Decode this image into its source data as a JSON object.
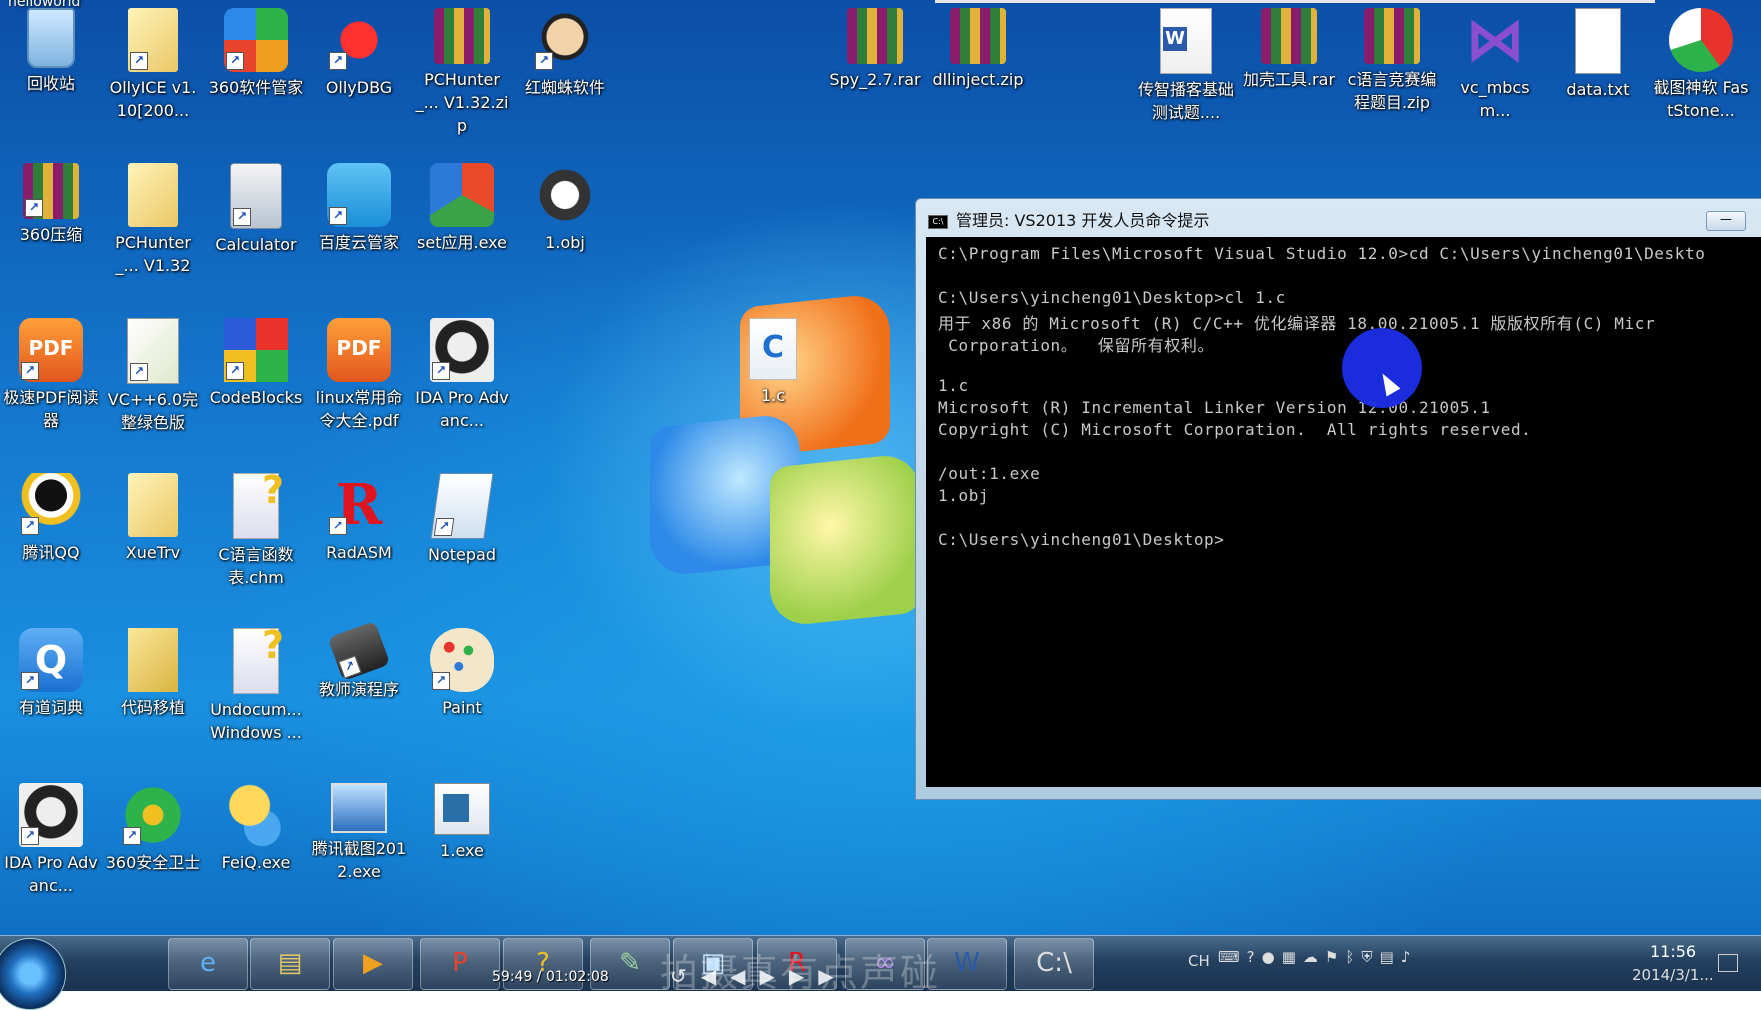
{
  "top_caption": "helloworld",
  "desktop_icons": [
    {
      "label": "回收站",
      "icon": "recycle-bin-icon"
    },
    {
      "label": "OllyICE v1.10[200...",
      "icon": "folder-icon"
    },
    {
      "label": "360软件管家",
      "icon": "360-software-manager-icon"
    },
    {
      "label": "OllyDBG",
      "icon": "ollydbg-icon"
    },
    {
      "label": "PCHunter_... V1.32.zip",
      "icon": "winrar-archive-icon"
    },
    {
      "label": "红蜘蛛软件",
      "icon": "red-spider-icon"
    },
    {
      "label": "Spy_2.7.rar",
      "icon": "winrar-archive-icon"
    },
    {
      "label": "dllinject.zip",
      "icon": "winrar-archive-icon"
    },
    {
      "label": "传智播客基础测试题....",
      "icon": "word-document-icon"
    },
    {
      "label": "加壳工具.rar",
      "icon": "winrar-archive-icon"
    },
    {
      "label": "c语言竞赛编程题目.zip",
      "icon": "winrar-archive-icon"
    },
    {
      "label": "vc_mbcsm...",
      "icon": "visual-studio-icon"
    },
    {
      "label": "data.txt",
      "icon": "text-file-icon"
    },
    {
      "label": "截图神软 FastStone...",
      "icon": "faststone-icon"
    },
    {
      "label": "360压缩",
      "icon": "winrar-archive-icon"
    },
    {
      "label": "PCHunter_... V1.32",
      "icon": "folder-icon"
    },
    {
      "label": "Calculator",
      "icon": "calculator-icon"
    },
    {
      "label": "百度云管家",
      "icon": "baidu-cloud-icon"
    },
    {
      "label": "set应用.exe",
      "icon": "office-icon"
    },
    {
      "label": "1.obj",
      "icon": "obj-file-icon"
    },
    {
      "label": "极速PDF阅读器",
      "icon": "pdf-reader-icon"
    },
    {
      "label": "VC++6.0完整绿色版",
      "icon": "vc6-folder-icon"
    },
    {
      "label": "CodeBlocks",
      "icon": "codeblocks-icon"
    },
    {
      "label": "linux常用命令大全.pdf",
      "icon": "pdf-file-icon"
    },
    {
      "label": "IDA Pro Advanc...",
      "icon": "ida-pro-icon"
    },
    {
      "label": "腾讯QQ",
      "icon": "qq-penguin-icon"
    },
    {
      "label": "XueTrv",
      "icon": "folder-icon"
    },
    {
      "label": "C语言函数表.chm",
      "icon": "chm-help-icon"
    },
    {
      "label": "RadASM",
      "icon": "radasm-icon"
    },
    {
      "label": "Notepad",
      "icon": "notepad-icon"
    },
    {
      "label": "有道词典",
      "icon": "youdao-dict-icon"
    },
    {
      "label": "代码移植",
      "icon": "folder-icon"
    },
    {
      "label": "Undocum... Windows ...",
      "icon": "chm-help-icon"
    },
    {
      "label": "教师演程序",
      "icon": "camera-icon"
    },
    {
      "label": "Paint",
      "icon": "paint-palette-icon"
    },
    {
      "label": "IDA Pro Advanc...",
      "icon": "ida-pro-icon"
    },
    {
      "label": "360安全卫士",
      "icon": "360-security-icon"
    },
    {
      "label": "FeiQ.exe",
      "icon": "feiq-icon"
    },
    {
      "label": "腾讯截图2012.exe",
      "icon": "screenshot-tool-icon"
    },
    {
      "label": "1.exe",
      "icon": "exe-file-icon"
    },
    {
      "label": "1.c",
      "icon": "c-source-file-icon"
    }
  ],
  "console": {
    "title": "管理员: VS2013 开发人员命令提示",
    "minimize_label": "—",
    "lines": [
      "C:\\Program Files\\Microsoft Visual Studio 12.0>cd C:\\Users\\yincheng01\\Deskto",
      "",
      "C:\\Users\\yincheng01\\Desktop>cl 1.c",
      "用于 x86 的 Microsoft (R) C/C++ 优化编译器 18.00.21005.1 版版权所有(C) Micr",
      " Corporation。  保留所有权利。",
      "",
      "1.c",
      "Microsoft (R) Incremental Linker Version 12.00.21005.1",
      "Copyright (C) Microsoft Corporation.  All rights reserved.",
      "",
      "/out:1.exe",
      "1.obj",
      "",
      "C:\\Users\\yincheng01\\Desktop>"
    ]
  },
  "taskbar": {
    "media_time": "59:49 / 01:02:08",
    "watermark": "拍摄真有点声碰",
    "language": "CH",
    "clock": "11:56",
    "date": "2014/3/1...",
    "pinned": [
      {
        "icon": "internet-explorer-icon",
        "glyph": "e"
      },
      {
        "icon": "file-explorer-icon",
        "glyph": "▤"
      },
      {
        "icon": "media-player-icon",
        "glyph": "▶"
      },
      {
        "icon": "powerpoint-icon",
        "glyph": "P"
      },
      {
        "icon": "chm-help-icon",
        "glyph": "?"
      },
      {
        "icon": "notepad-icon",
        "glyph": "✎"
      },
      {
        "icon": "screenshot-tool-icon",
        "glyph": "▣"
      },
      {
        "icon": "radasm-icon",
        "glyph": "R"
      },
      {
        "icon": "visual-studio-icon",
        "glyph": "∞"
      },
      {
        "icon": "word-icon",
        "glyph": "W"
      },
      {
        "icon": "console-icon",
        "glyph": "C:\\"
      }
    ]
  }
}
